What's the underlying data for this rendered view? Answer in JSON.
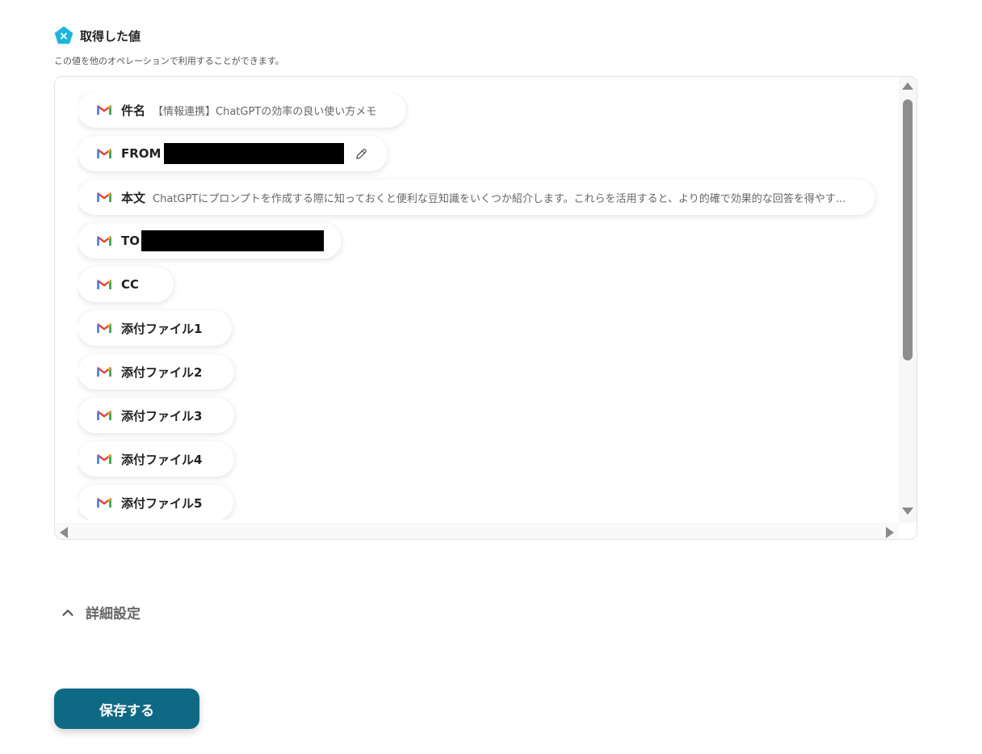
{
  "section": {
    "title": "取得した値",
    "description": "この値を他のオペレーションで利用することができます。",
    "icon": "variable-x-icon",
    "icon_color": "#1bb6d9"
  },
  "items": [
    {
      "label": "件名",
      "value": "【情報連携】ChatGPTの効率の良い使い方メモ",
      "icon": "gmail-icon"
    },
    {
      "label": "FROM",
      "value": "",
      "icon": "gmail-icon",
      "redacted": true,
      "editable": true
    },
    {
      "label": "本文",
      "value": "ChatGPTにプロンプトを作成する際に知っておくと便利な豆知識をいくつか紹介します。これらを活用すると、より的確で効果的な回答を得やす...",
      "icon": "gmail-icon"
    },
    {
      "label": "TO",
      "value": "",
      "icon": "gmail-icon",
      "redacted": true
    },
    {
      "label": "CC",
      "value": "",
      "icon": "gmail-icon"
    },
    {
      "label": "添付ファイル1",
      "value": "",
      "icon": "gmail-icon"
    },
    {
      "label": "添付ファイル2",
      "value": "",
      "icon": "gmail-icon"
    },
    {
      "label": "添付ファイル3",
      "value": "",
      "icon": "gmail-icon"
    },
    {
      "label": "添付ファイル4",
      "value": "",
      "icon": "gmail-icon"
    },
    {
      "label": "添付ファイル5",
      "value": "",
      "icon": "gmail-icon"
    }
  ],
  "advanced": {
    "label": "詳細設定",
    "icon": "chevron-up-icon"
  },
  "save_button": {
    "label": "保存する",
    "color": "#0e6985"
  }
}
